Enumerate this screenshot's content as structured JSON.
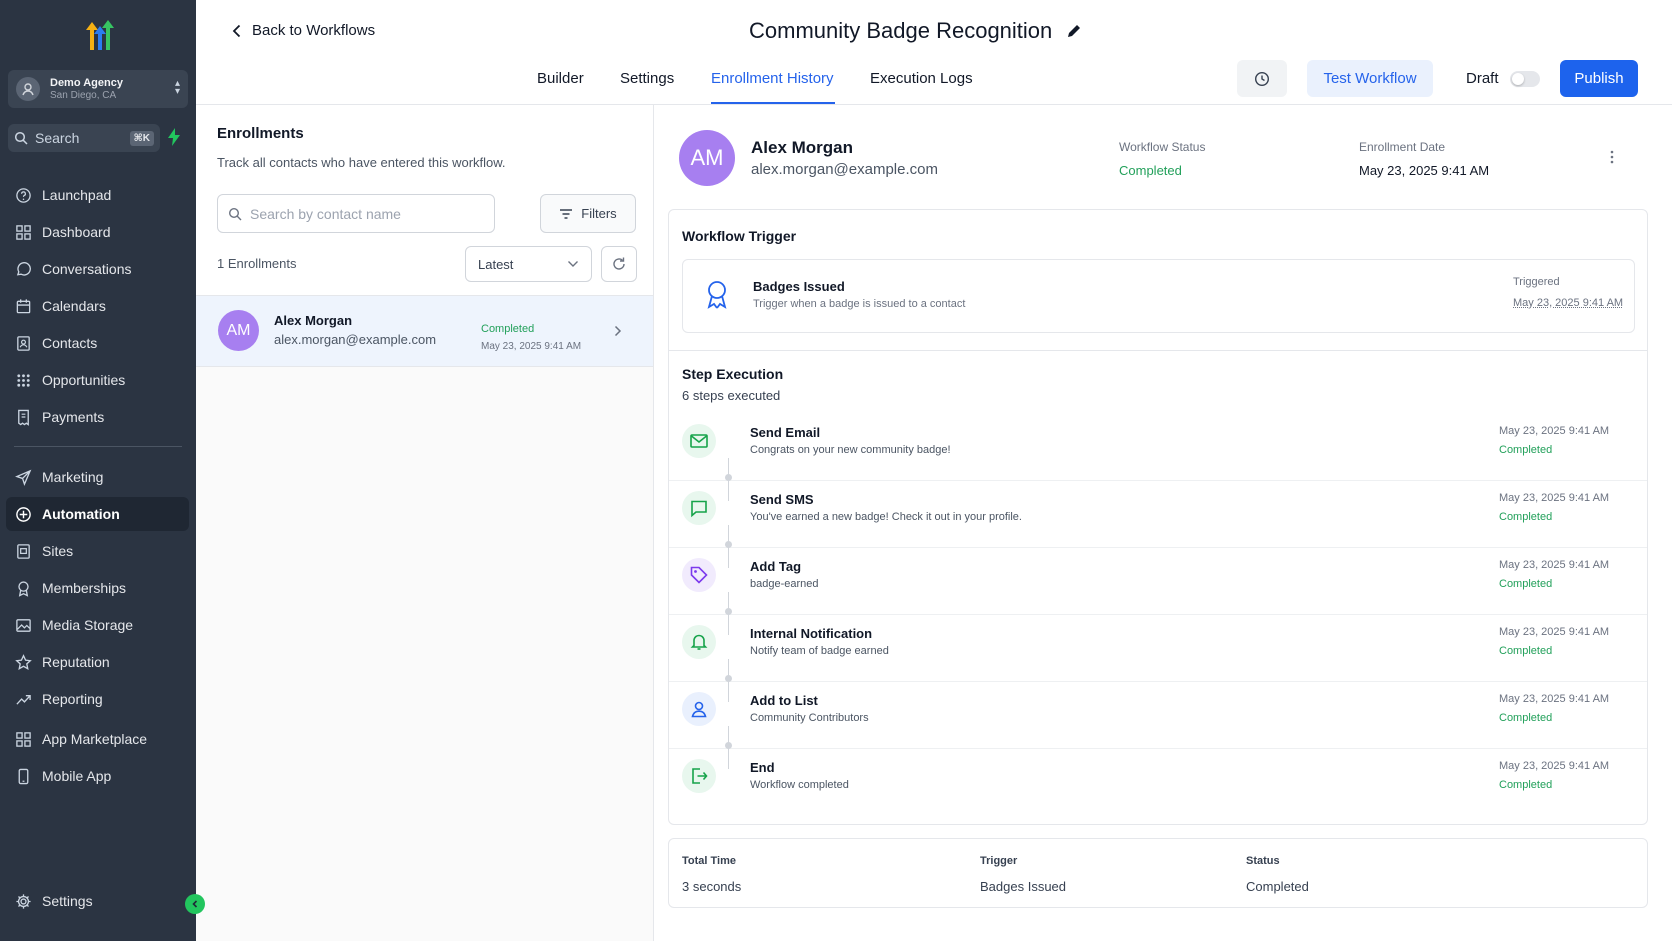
{
  "sidebar": {
    "agency_name": "Demo Agency",
    "agency_location": "San Diego, CA",
    "search_label": "Search",
    "search_shortcut": "⌘K",
    "items": [
      {
        "label": "Launchpad",
        "icon": "rocket-icon"
      },
      {
        "label": "Dashboard",
        "icon": "grid-icon"
      },
      {
        "label": "Conversations",
        "icon": "chat-icon"
      },
      {
        "label": "Calendars",
        "icon": "calendar-icon"
      },
      {
        "label": "Contacts",
        "icon": "contacts-icon"
      },
      {
        "label": "Opportunities",
        "icon": "pipeline-icon"
      },
      {
        "label": "Payments",
        "icon": "receipt-icon"
      },
      {
        "label": "Marketing",
        "icon": "send-icon"
      },
      {
        "label": "Automation",
        "icon": "automation-icon",
        "active": true
      },
      {
        "label": "Sites",
        "icon": "sites-icon"
      },
      {
        "label": "Memberships",
        "icon": "award-icon"
      },
      {
        "label": "Media Storage",
        "icon": "image-icon"
      },
      {
        "label": "Reputation",
        "icon": "star-icon"
      },
      {
        "label": "Reporting",
        "icon": "trend-icon"
      },
      {
        "label": "App Marketplace",
        "icon": "apps-icon"
      },
      {
        "label": "Mobile App",
        "icon": "phone-icon"
      }
    ],
    "settings_label": "Settings"
  },
  "header": {
    "back_label": "Back to Workflows",
    "title": "Community Badge Recognition",
    "tabs": [
      {
        "label": "Builder"
      },
      {
        "label": "Settings"
      },
      {
        "label": "Enrollment History",
        "active": true
      },
      {
        "label": "Execution Logs"
      }
    ],
    "test_label": "Test Workflow",
    "draft_label": "Draft",
    "publish_label": "Publish"
  },
  "enrollments": {
    "title": "Enrollments",
    "subtitle": "Track all contacts who have entered this workflow.",
    "search_placeholder": "Search by contact name",
    "filters_label": "Filters",
    "count_label": "1 Enrollments",
    "sort_value": "Latest",
    "rows": [
      {
        "initials": "AM",
        "name": "Alex Morgan",
        "email": "alex.morgan@example.com",
        "status": "Completed",
        "date": "May 23, 2025 9:41 AM"
      }
    ]
  },
  "detail": {
    "initials": "AM",
    "name": "Alex Morgan",
    "email": "alex.morgan@example.com",
    "status_label": "Workflow Status",
    "status_value": "Completed",
    "date_label": "Enrollment Date",
    "date_value": "May 23, 2025 9:41 AM",
    "trigger_section": "Workflow Trigger",
    "trigger": {
      "name": "Badges Issued",
      "description": "Trigger when a badge is issued to a contact",
      "label": "Triggered",
      "date": "May 23, 2025 9:41 AM"
    },
    "steps_section": "Step Execution",
    "steps_count": "6 steps executed",
    "steps": [
      {
        "name": "Send Email",
        "desc": "Congrats on your new community badge!",
        "date": "May 23, 2025 9:41 AM",
        "status": "Completed",
        "icon": "mail-icon",
        "color": "#16a34a",
        "bg": "#e8f7ee"
      },
      {
        "name": "Send SMS",
        "desc": "You've earned a new badge! Check it out in your profile.",
        "date": "May 23, 2025 9:41 AM",
        "status": "Completed",
        "icon": "message-icon",
        "color": "#16a34a",
        "bg": "#e8f7ee"
      },
      {
        "name": "Add Tag",
        "desc": "badge-earned",
        "date": "May 23, 2025 9:41 AM",
        "status": "Completed",
        "icon": "tag-icon",
        "color": "#7c3aed",
        "bg": "#f1ebfd"
      },
      {
        "name": "Internal Notification",
        "desc": "Notify team of badge earned",
        "date": "May 23, 2025 9:41 AM",
        "status": "Completed",
        "icon": "bell-icon",
        "color": "#16a34a",
        "bg": "#e8f7ee"
      },
      {
        "name": "Add to List",
        "desc": "Community Contributors",
        "date": "May 23, 2025 9:41 AM",
        "status": "Completed",
        "icon": "user-icon",
        "color": "#2563eb",
        "bg": "#e9f0fd"
      },
      {
        "name": "End",
        "desc": "Workflow completed",
        "date": "May 23, 2025 9:41 AM",
        "status": "Completed",
        "icon": "exit-icon",
        "color": "#16a34a",
        "bg": "#e8f7ee"
      }
    ],
    "summary": {
      "total_label": "Total Time",
      "total_value": "3 seconds",
      "trigger_label": "Trigger",
      "trigger_value": "Badges Issued",
      "status_label": "Status",
      "status_value": "Completed"
    }
  },
  "colors": {
    "sidebar_bg": "#2b3442",
    "accent": "#2563eb",
    "publish": "#1d63ed",
    "success": "#22a05a",
    "avatar": "#a77ff0"
  }
}
